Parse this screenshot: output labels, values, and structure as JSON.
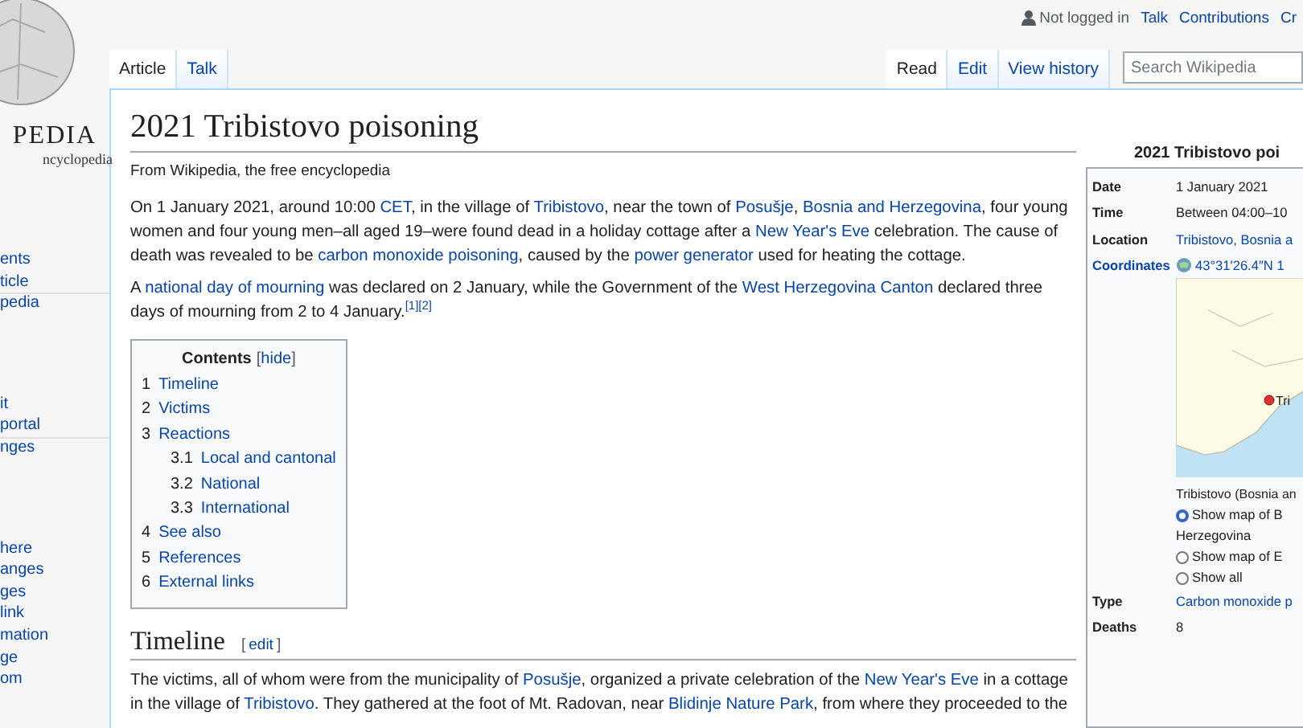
{
  "header": {
    "user_status": "Not logged in",
    "links": [
      "Talk",
      "Contributions",
      "Cr"
    ]
  },
  "logo": {
    "wordmark": "PEDIA",
    "tagline": "ncyclopedia"
  },
  "sidebar": {
    "groups": [
      {
        "items": [
          "ents",
          "ticle",
          "pedia"
        ]
      },
      {
        "items": [
          "it",
          "portal",
          "nges"
        ]
      },
      {
        "items": [
          "here",
          "anges",
          "ges",
          "link",
          "mation",
          "ge",
          "om"
        ]
      }
    ]
  },
  "tabs_left": [
    {
      "label": "Article",
      "selected": true
    },
    {
      "label": "Talk",
      "selected": false
    }
  ],
  "tabs_right": [
    {
      "label": "Read",
      "selected": true
    },
    {
      "label": "Edit",
      "selected": false
    },
    {
      "label": "View history",
      "selected": false
    }
  ],
  "search": {
    "placeholder": "Search Wikipedia"
  },
  "article": {
    "title": "2021 Tribistovo poisoning",
    "tagline": "From Wikipedia, the free encyclopedia",
    "paragraphs": [
      [
        {
          "kind": "text",
          "text": "On 1 January 2021, around 10:00 "
        },
        {
          "kind": "link",
          "text": "CET"
        },
        {
          "kind": "text",
          "text": ", in the village of "
        },
        {
          "kind": "link",
          "text": "Tribistovo"
        },
        {
          "kind": "text",
          "text": ", near the town of "
        },
        {
          "kind": "link",
          "text": "Posušje"
        },
        {
          "kind": "text",
          "text": ", "
        },
        {
          "kind": "link",
          "text": "Bosnia and Herzegovina"
        },
        {
          "kind": "text",
          "text": ", four young women and four young men–all aged 19–were found dead in a holiday cottage after a "
        },
        {
          "kind": "link",
          "text": "New Year's Eve"
        },
        {
          "kind": "text",
          "text": " celebration. The cause of death was revealed to be "
        },
        {
          "kind": "link",
          "text": "carbon monoxide poisoning"
        },
        {
          "kind": "text",
          "text": ", caused by the "
        },
        {
          "kind": "link",
          "text": "power generator"
        },
        {
          "kind": "text",
          "text": " used for heating the cottage."
        }
      ],
      [
        {
          "kind": "text",
          "text": "A "
        },
        {
          "kind": "link",
          "text": "national day of mourning"
        },
        {
          "kind": "text",
          "text": " was declared on 2 January, while the Government of the "
        },
        {
          "kind": "link",
          "text": "West Herzegovina Canton"
        },
        {
          "kind": "text",
          "text": " declared three days of mourning from 2 to 4 January."
        },
        {
          "kind": "ref",
          "text": "[1]"
        },
        {
          "kind": "ref",
          "text": "[2]"
        }
      ]
    ],
    "toc": {
      "title": "Contents",
      "toggle": {
        "open": "[",
        "label": "hide",
        "close": "]"
      },
      "entries": [
        {
          "number": "1",
          "label": "Timeline"
        },
        {
          "number": "2",
          "label": "Victims"
        },
        {
          "number": "3",
          "label": "Reactions",
          "children": [
            {
              "number": "3.1",
              "label": "Local and cantonal"
            },
            {
              "number": "3.2",
              "label": "National"
            },
            {
              "number": "3.3",
              "label": "International"
            }
          ]
        },
        {
          "number": "4",
          "label": "See also"
        },
        {
          "number": "5",
          "label": "References"
        },
        {
          "number": "6",
          "label": "External links"
        }
      ]
    },
    "sections": [
      {
        "heading": "Timeline",
        "edit": {
          "open": "[",
          "label": "edit",
          "close": "]"
        },
        "paragraphs": [
          [
            {
              "kind": "text",
              "text": "The victims, all of whom were from the municipality of "
            },
            {
              "kind": "link",
              "text": "Posušje"
            },
            {
              "kind": "text",
              "text": ", organized a private celebration of the "
            },
            {
              "kind": "link",
              "text": "New Year's Eve"
            },
            {
              "kind": "text",
              "text": " in a cottage in the village of "
            },
            {
              "kind": "link",
              "text": "Tribistovo"
            },
            {
              "kind": "text",
              "text": ". They gathered at the foot of Mt. Radovan, near "
            },
            {
              "kind": "link",
              "text": "Blidinje Nature Park"
            },
            {
              "kind": "text",
              "text": ", from where they proceeded to the"
            }
          ]
        ]
      }
    ]
  },
  "infobox": {
    "title": "2021 Tribistovo poi",
    "rows": [
      {
        "kind": "text",
        "label": "Date",
        "value": "1 January 2021"
      },
      {
        "kind": "text",
        "label": "Time",
        "value": "Between 04:00–10"
      },
      {
        "kind": "link",
        "label": "Location",
        "value": "Tribistovo, Bosnia a"
      },
      {
        "kind": "coords",
        "label": "Coordinates",
        "value": "43°31′26.4″N 1"
      },
      {
        "kind": "map",
        "map_label": "Tri",
        "caption": "Tribistovo (Bosnia an",
        "options": [
          {
            "label": "Show map of B",
            "extra": "Herzegovina",
            "selected": true
          },
          {
            "label": "Show map of E",
            "selected": false
          },
          {
            "label": "Show all",
            "selected": false
          }
        ]
      },
      {
        "kind": "link",
        "label": "Type",
        "value": "Carbon monoxide p"
      },
      {
        "kind": "text",
        "label": "Deaths",
        "value": "8"
      }
    ]
  }
}
